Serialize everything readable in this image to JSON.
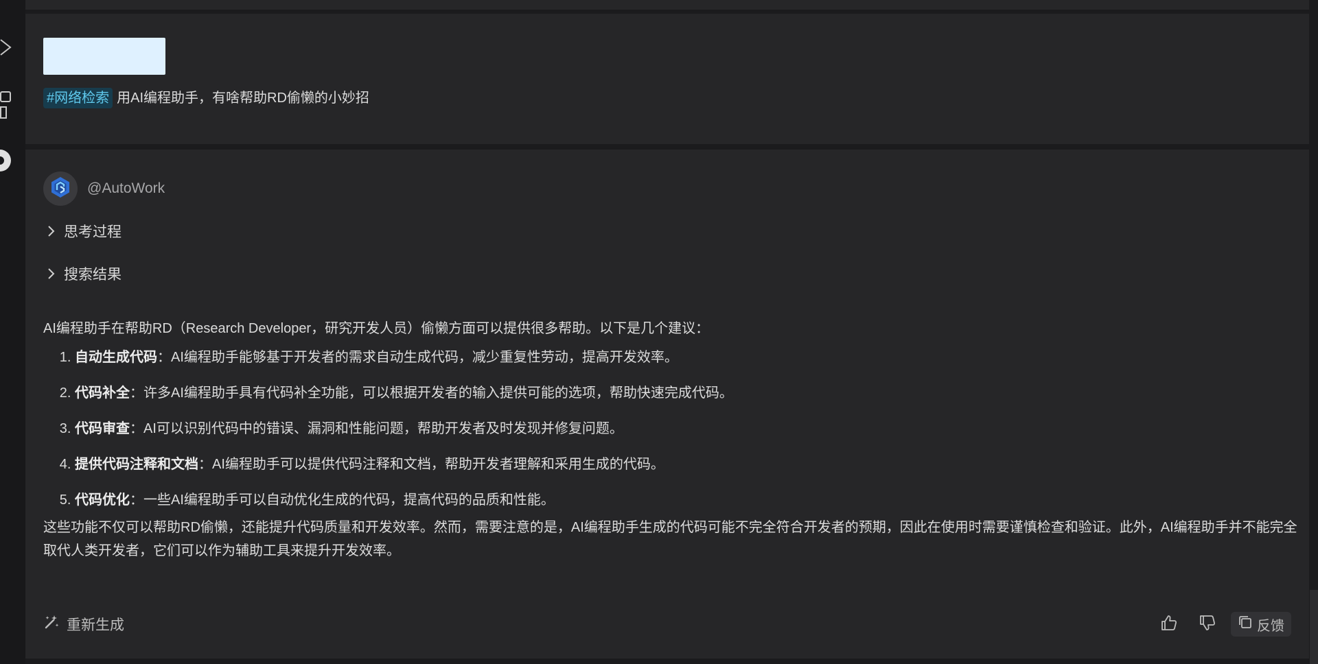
{
  "user_message": {
    "tag": "#网络检索",
    "text": "用AI编程助手，有啥帮助RD偷懒的小妙招"
  },
  "assistant": {
    "name": "@AutoWork",
    "thinking_label": "思考过程",
    "search_label": "搜索结果",
    "intro": "AI编程助手在帮助RD（Research Developer，研究开发人员）偷懒方面可以提供很多帮助。以下是几个建议：",
    "items": [
      {
        "title": "自动生成代码",
        "text": "：AI编程助手能够基于开发者的需求自动生成代码，减少重复性劳动，提高开发效率。"
      },
      {
        "title": "代码补全",
        "text": "：许多AI编程助手具有代码补全功能，可以根据开发者的输入提供可能的选项，帮助快速完成代码。"
      },
      {
        "title": "代码审查",
        "text": "：AI可以识别代码中的错误、漏洞和性能问题，帮助开发者及时发现并修复问题。"
      },
      {
        "title": "提供代码注释和文档",
        "text": "：AI编程助手可以提供代码注释和文档，帮助开发者理解和采用生成的代码。"
      },
      {
        "title": "代码优化",
        "text": "：一些AI编程助手可以自动优化生成的代码，提高代码的品质和性能。"
      }
    ],
    "conclusion": "这些功能不仅可以帮助RD偷懒，还能提升代码质量和开发效率。然而，需要注意的是，AI编程助手生成的代码可能不完全符合开发者的预期，因此在使用时需要谨慎检查和验证。此外，AI编程助手并不能完全取代人类开发者，它们可以作为辅助工具来提升开发效率。"
  },
  "footer": {
    "regenerate_label": "重新生成",
    "feedback_label": "反馈"
  },
  "icons": {
    "run": "play-icon",
    "extensions": "extensions-icon",
    "app": "app-logo-icon",
    "bot": "autowork-logo-icon",
    "regenerate": "magic-wand-icon",
    "like": "thumbs-up-icon",
    "dislike": "thumbs-down-icon",
    "feedback": "copy-icon"
  },
  "colors": {
    "tag_bg": "#173c4d",
    "tag_text": "#5fc8ec",
    "panel_bg": "#262628",
    "page_bg": "#1b1b1d"
  }
}
